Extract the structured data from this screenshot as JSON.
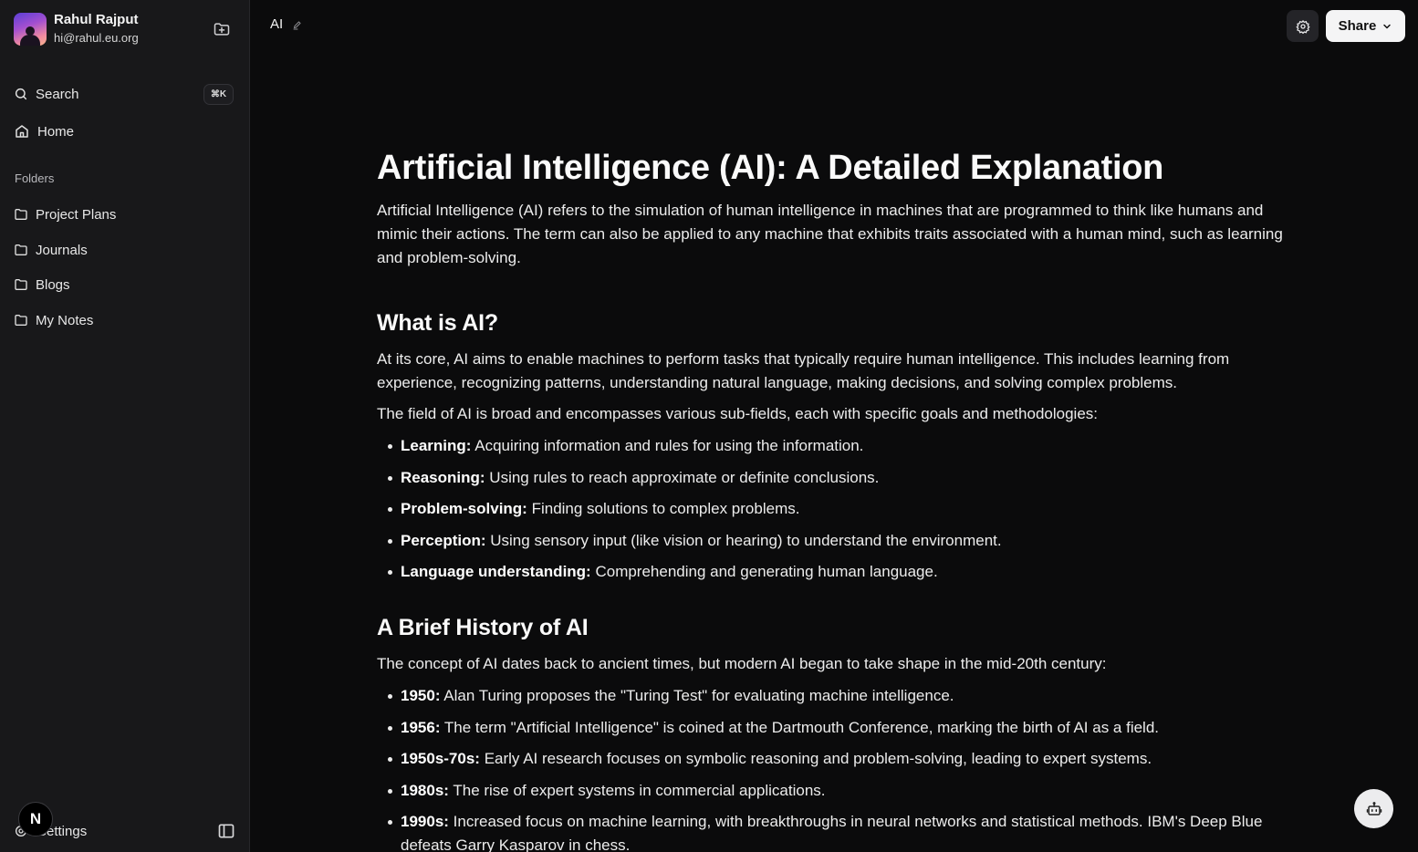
{
  "user": {
    "name": "Rahul Rajput",
    "email": "hi@rahul.eu.org"
  },
  "nav": {
    "search_label": "Search",
    "search_shortcut": "⌘K",
    "home_label": "Home"
  },
  "folders": {
    "section_label": "Folders",
    "items": [
      {
        "label": "Project Plans"
      },
      {
        "label": "Journals"
      },
      {
        "label": "Blogs"
      },
      {
        "label": "My Notes"
      }
    ]
  },
  "footer": {
    "settings_label": "Settings",
    "badge_letter": "N"
  },
  "topbar": {
    "doc_title": "AI",
    "share_label": "Share"
  },
  "document": {
    "title": "Artificial Intelligence (AI): A Detailed Explanation",
    "intro": "Artificial Intelligence (AI) refers to the simulation of human intelligence in machines that are programmed to think like humans and mimic their actions. The term can also be applied to any machine that exhibits traits associated with a human mind, such as learning and problem-solving.",
    "what_heading": "What is AI?",
    "what_p1": "At its core, AI aims to enable machines to perform tasks that typically require human intelligence. This includes learning from experience, recognizing patterns, understanding natural language, making decisions, and solving complex problems.",
    "what_p2": "The field of AI is broad and encompasses various sub-fields, each with specific goals and methodologies:",
    "subfields": [
      {
        "term": "Learning:",
        "text": " Acquiring information and rules for using the information."
      },
      {
        "term": "Reasoning:",
        "text": " Using rules to reach approximate or definite conclusions."
      },
      {
        "term": "Problem-solving:",
        "text": " Finding solutions to complex problems."
      },
      {
        "term": "Perception:",
        "text": " Using sensory input (like vision or hearing) to understand the environment."
      },
      {
        "term": "Language understanding:",
        "text": " Comprehending and generating human language."
      }
    ],
    "history_heading": "A Brief History of AI",
    "history_intro": "The concept of AI dates back to ancient times, but modern AI began to take shape in the mid-20th century:",
    "history": [
      {
        "term": "1950:",
        "text": " Alan Turing proposes the \"Turing Test\" for evaluating machine intelligence."
      },
      {
        "term": "1956:",
        "text": " The term \"Artificial Intelligence\" is coined at the Dartmouth Conference, marking the birth of AI as a field."
      },
      {
        "term": "1950s-70s:",
        "text": " Early AI research focuses on symbolic reasoning and problem-solving, leading to expert systems."
      },
      {
        "term": "1980s:",
        "text": " The rise of expert systems in commercial applications."
      },
      {
        "term": "1990s:",
        "text": " Increased focus on machine learning, with breakthroughs in neural networks and statistical methods. IBM's Deep Blue defeats Garry Kasparov in chess."
      }
    ]
  }
}
